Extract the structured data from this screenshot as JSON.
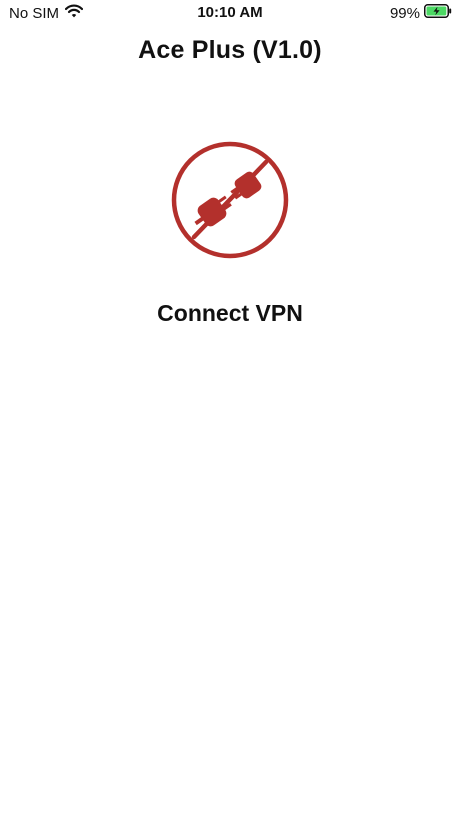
{
  "status_bar": {
    "carrier": "No SIM",
    "time": "10:10 AM",
    "battery_percent": "99%",
    "battery_level": 0.99,
    "battery_charging": true,
    "icons": [
      "wifi-icon",
      "battery-charging-icon"
    ]
  },
  "nav": {
    "title": "Ace Plus (V1.0)"
  },
  "main": {
    "connect_label": "Connect VPN",
    "toggle_icon": "plug-disconnected-icon",
    "state": "disconnected"
  },
  "colors": {
    "accent": "#b3302c",
    "battery_fill": "#4cd964",
    "text": "#111111",
    "background": "#ffffff"
  }
}
